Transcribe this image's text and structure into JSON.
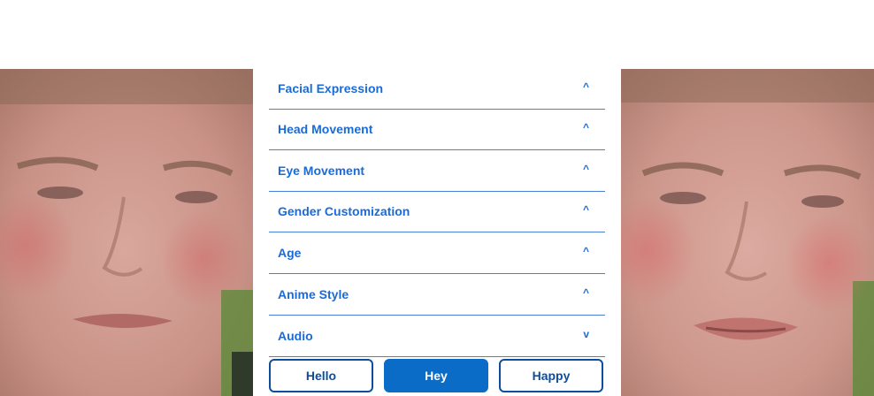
{
  "sections": [
    {
      "label": "Facial Expression",
      "chevron": "^"
    },
    {
      "label": "Head Movement",
      "chevron": "^"
    },
    {
      "label": "Eye Movement",
      "chevron": "^"
    },
    {
      "label": "Gender Customization",
      "chevron": "^"
    },
    {
      "label": "Age",
      "chevron": "^"
    },
    {
      "label": "Anime Style",
      "chevron": "^"
    },
    {
      "label": "Audio",
      "chevron": "v"
    }
  ],
  "buttons": [
    {
      "label": "Hello",
      "style": "outline"
    },
    {
      "label": "Hey",
      "style": "filled"
    },
    {
      "label": "Happy",
      "style": "outline"
    }
  ],
  "colors": {
    "accent": "#1a6bd8",
    "button_dark": "#0c4d9e",
    "button_fill": "#0b6cc8",
    "divider": "#4a7fd6"
  }
}
